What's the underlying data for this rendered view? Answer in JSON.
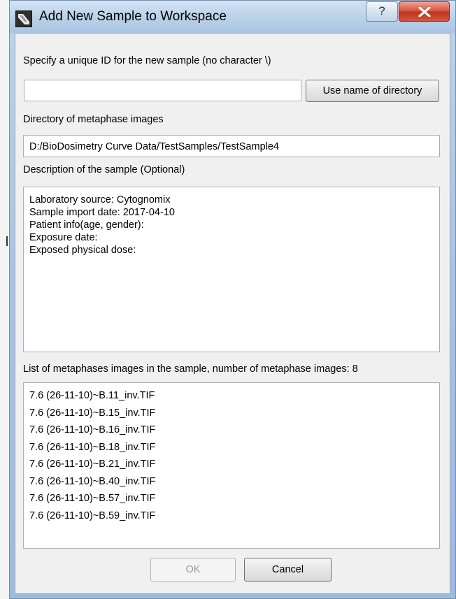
{
  "window": {
    "title": "Add New Sample to Workspace",
    "help_glyph": "?"
  },
  "form": {
    "id_label": "Specify a unique ID for the new sample (no character \\)",
    "id_value": "",
    "use_dir_button": "Use name of directory",
    "dir_label": "Directory of metaphase images",
    "dir_value": "D:/BioDosimetry Curve Data/TestSamples/TestSample4",
    "desc_label": "Description of the sample (Optional)",
    "description": [
      "Laboratory source: Cytognomix",
      "Sample import date: 2017-04-10",
      "Patient info(age, gender):",
      "Exposure date:",
      "Exposed physical dose:"
    ],
    "list_label": "List of metaphases images in the sample, number of metaphase images: 8",
    "images": [
      "7.6 (26-11-10)~B.11_inv.TIF",
      "7.6 (26-11-10)~B.15_inv.TIF",
      "7.6 (26-11-10)~B.16_inv.TIF",
      "7.6 (26-11-10)~B.18_inv.TIF",
      "7.6 (26-11-10)~B.21_inv.TIF",
      "7.6 (26-11-10)~B.40_inv.TIF",
      "7.6 (26-11-10)~B.57_inv.TIF",
      "7.6 (26-11-10)~B.59_inv.TIF"
    ]
  },
  "buttons": {
    "ok": "OK",
    "cancel": "Cancel"
  },
  "icons": {
    "app": "sample-app-icon",
    "help": "help-icon",
    "close": "close-icon"
  }
}
